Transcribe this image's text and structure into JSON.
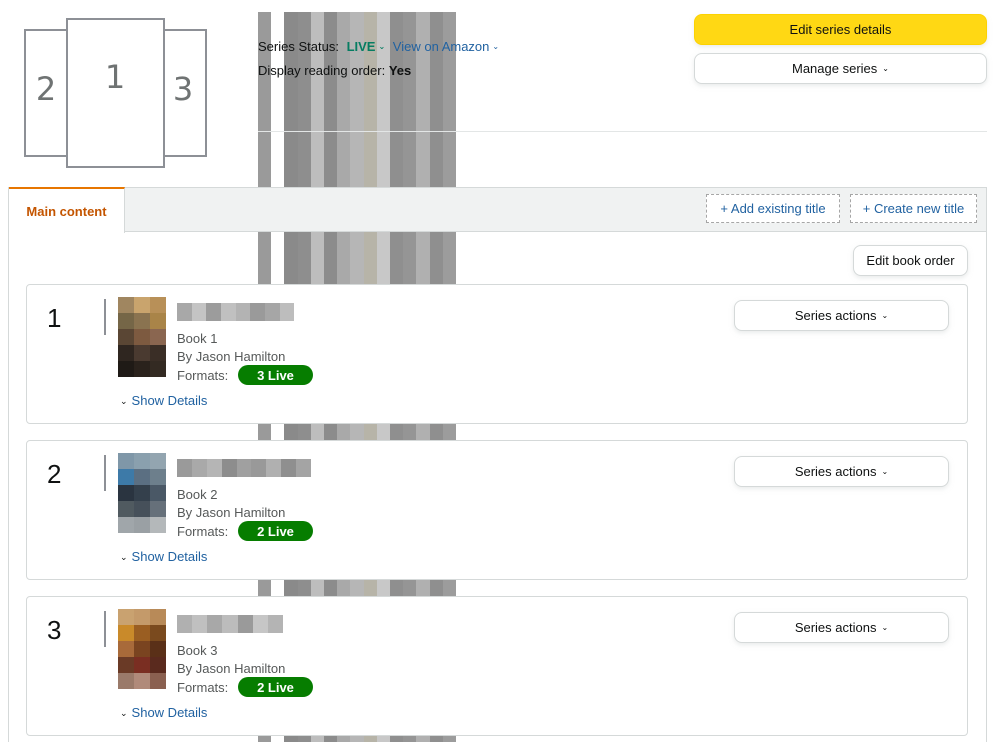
{
  "series": {
    "status_label": "Series Status:",
    "status_value": "LIVE",
    "view_on_amazon": "View on Amazon",
    "reading_order_label": "Display reading order:",
    "reading_order_value": "Yes",
    "logo_numbers": [
      "2",
      "1",
      "3"
    ]
  },
  "actions": {
    "edit_series_details": "Edit series details",
    "manage_series": "Manage series"
  },
  "tabs": {
    "main_content": "Main content",
    "add_existing_title": "+ Add existing title",
    "create_new_title": "+ Create new title",
    "edit_book_order": "Edit book order"
  },
  "books": [
    {
      "number": "1",
      "label": "Book 1",
      "author": "By Jason Hamilton",
      "formats_label": "Formats:",
      "live_badge": "3 Live",
      "show_details": "Show Details",
      "series_actions": "Series actions"
    },
    {
      "number": "2",
      "label": "Book 2",
      "author": "By Jason Hamilton",
      "formats_label": "Formats:",
      "live_badge": "2 Live",
      "show_details": "Show Details",
      "series_actions": "Series actions"
    },
    {
      "number": "3",
      "label": "Book 3",
      "author": "By Jason Hamilton",
      "formats_label": "Formats:",
      "live_badge": "2 Live",
      "show_details": "Show Details",
      "series_actions": "Series actions"
    }
  ],
  "colors": {
    "primary_button": "#ffd814",
    "live_green": "#067d62",
    "badge_green": "#067d00",
    "link_blue": "#2162a1",
    "active_tab_text": "#c45500",
    "active_tab_border": "#e77600"
  }
}
